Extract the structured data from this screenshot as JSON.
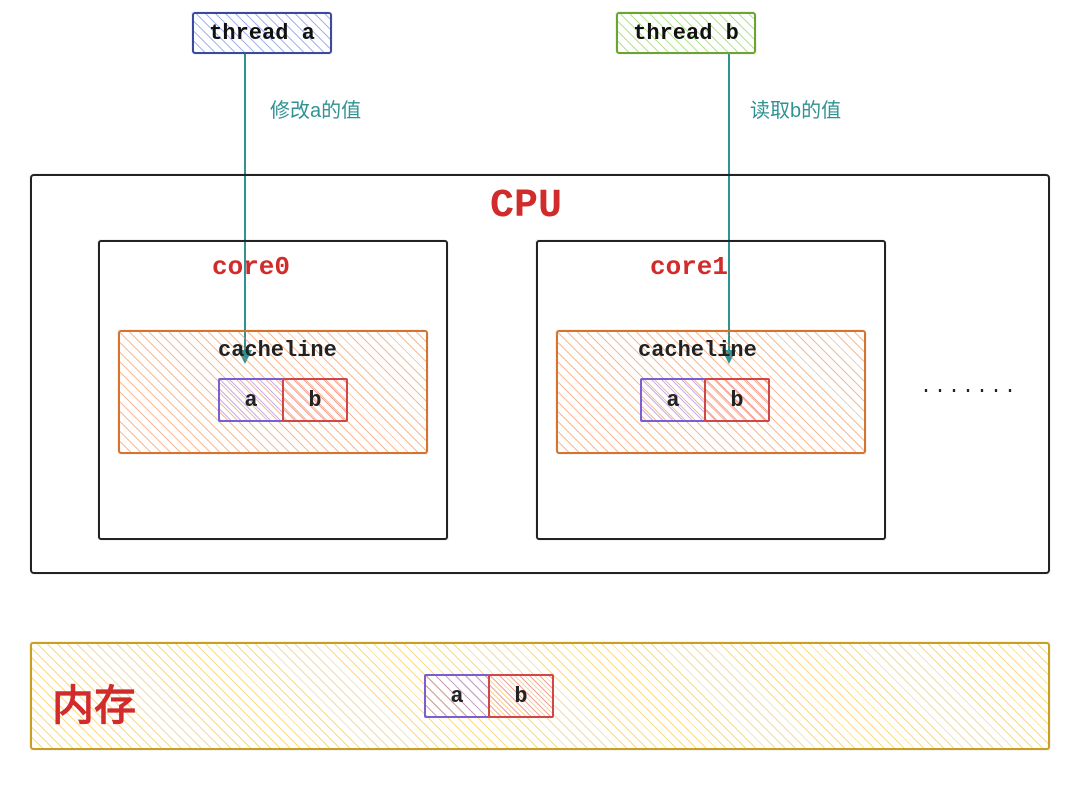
{
  "threads": {
    "a_label": "thread a",
    "b_label": "thread b"
  },
  "arrows": {
    "a_action": "修改a的值",
    "b_action": "读取b的值"
  },
  "cpu": {
    "title": "CPU",
    "cores": [
      {
        "name": "core0",
        "cacheline_label": "cacheline"
      },
      {
        "name": "core1",
        "cacheline_label": "cacheline"
      }
    ],
    "ellipsis": "·······"
  },
  "vars": {
    "a": "a",
    "b": "b"
  },
  "memory": {
    "title": "内存"
  },
  "colors": {
    "accent_red": "#d22b2b",
    "teal": "#2f9293",
    "orange": "#d6742e",
    "yellow": "#caa020",
    "purple": "#7c5ed0",
    "redcell": "#d14646",
    "blue": "#3a4aa0",
    "green": "#6aa52f"
  }
}
